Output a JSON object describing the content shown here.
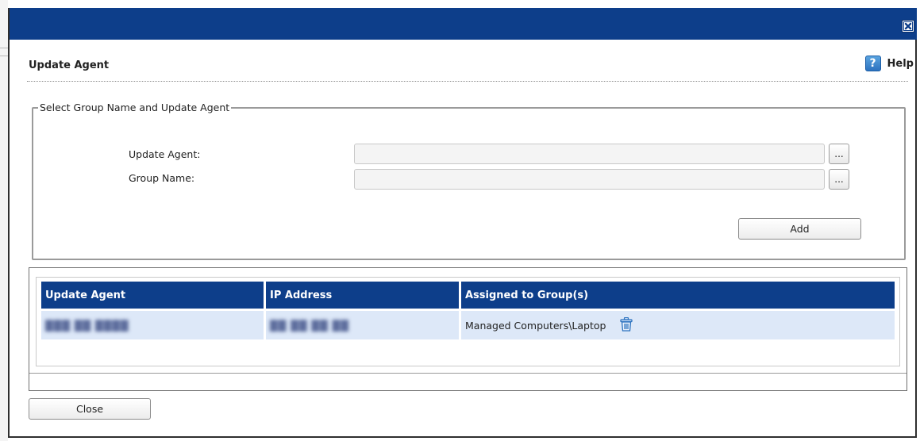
{
  "dialog": {
    "title": "Update Agent",
    "help_label": "Help",
    "help_icon": "?",
    "colors": {
      "titlebar": "#0d3e8a",
      "row_bg": "#dde8f8"
    }
  },
  "form": {
    "legend": "Select Group Name and Update Agent",
    "update_agent_label": "Update Agent:",
    "update_agent_value": "",
    "group_name_label": "Group Name:",
    "group_name_value": "",
    "browse_label": "...",
    "add_label": "Add"
  },
  "table": {
    "columns": [
      "Update Agent",
      "IP Address",
      "Assigned to Group(s)"
    ],
    "rows": [
      {
        "agent": "███ ██ ████",
        "ip": "██ ██ ██ ██",
        "group": "Managed Computers\\Laptop"
      }
    ]
  },
  "footer": {
    "close_label": "Close"
  }
}
